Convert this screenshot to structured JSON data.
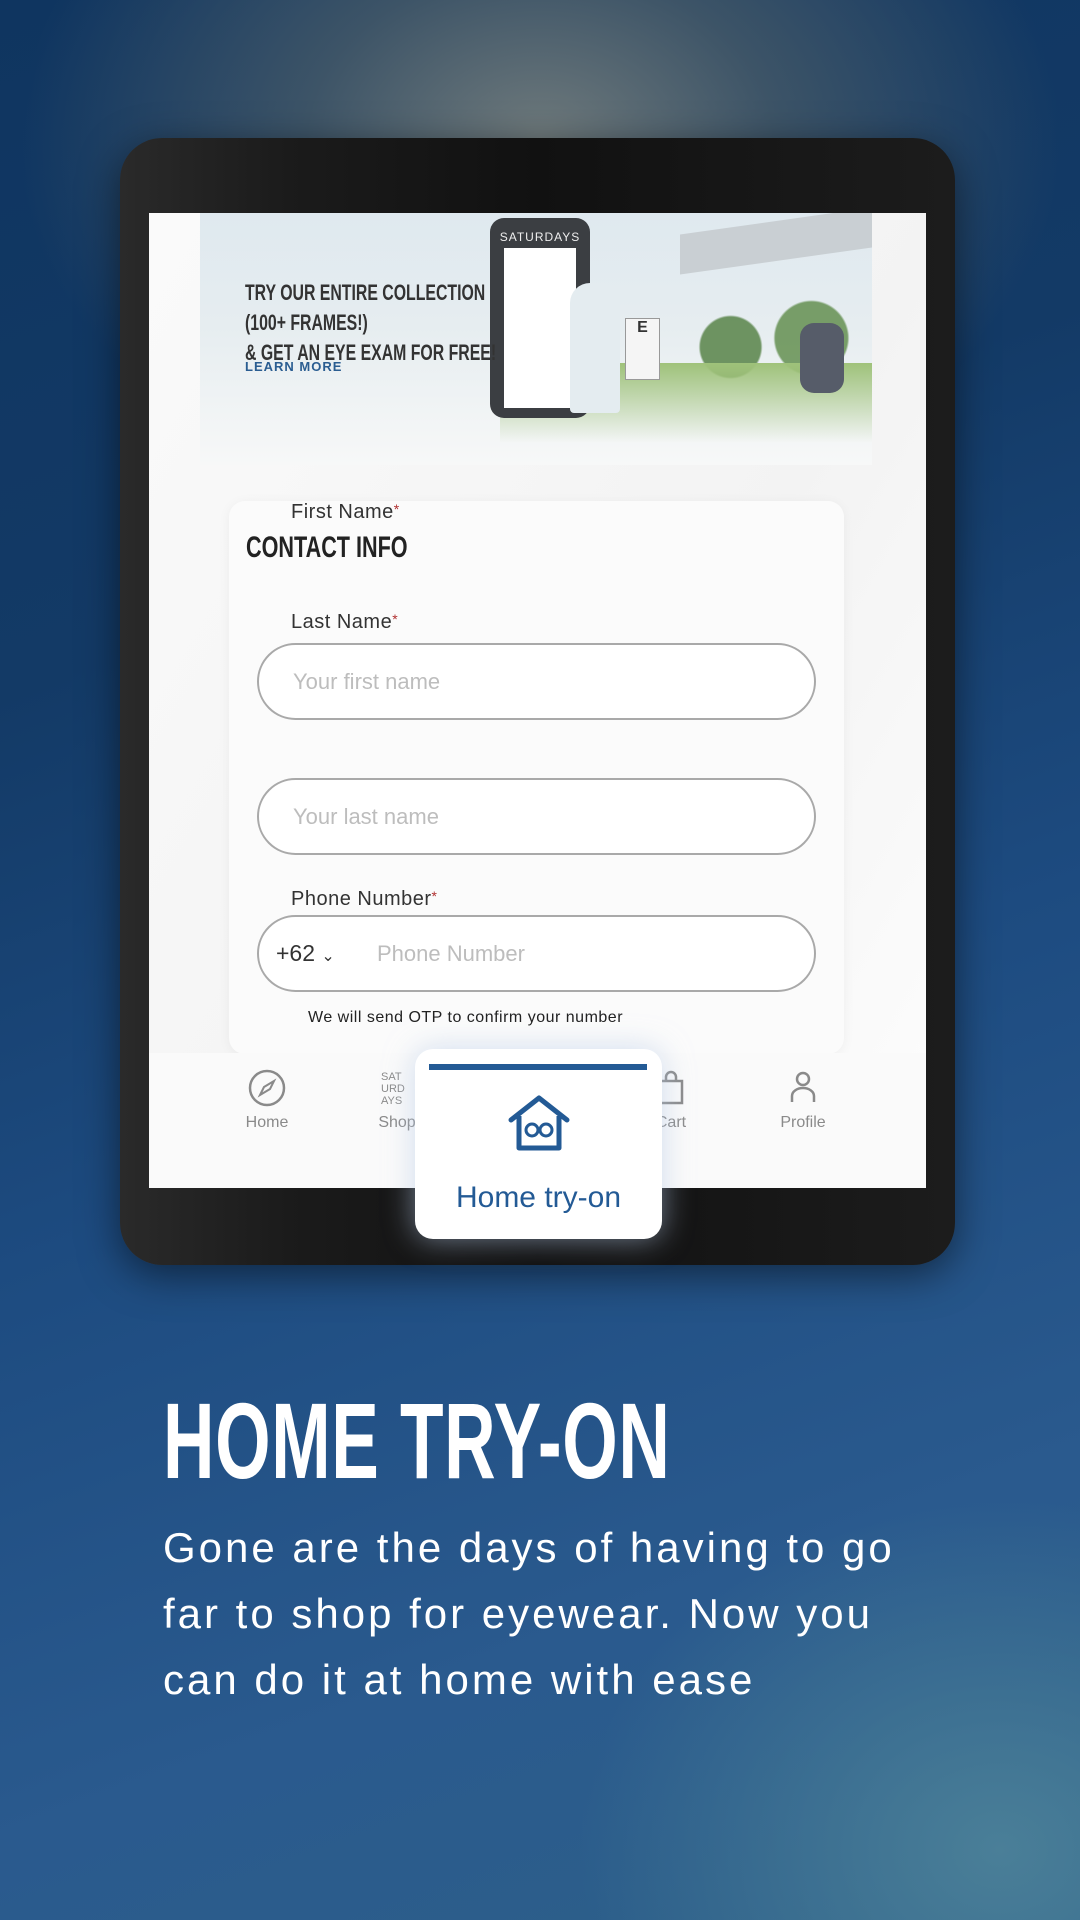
{
  "banner": {
    "headline": [
      "TRY OUR ENTIRE COLLECTION",
      "(100+ FRAMES!)",
      "& GET AN EYE EXAM FOR FREE!"
    ],
    "link": "LEARN MORE",
    "brand": "SATURDAYS"
  },
  "form": {
    "title": "CONTACT INFO",
    "required_mark": "*",
    "first_name": {
      "label": "First Name",
      "placeholder": "Your first name"
    },
    "last_name": {
      "label": "Last Name",
      "placeholder": "Your last name"
    },
    "phone": {
      "label": "Phone Number",
      "country_code": "+62",
      "placeholder": "Phone Number",
      "hint": "We will send OTP to confirm your number"
    }
  },
  "nav": {
    "items": [
      {
        "label": "Home",
        "icon": "compass-icon"
      },
      {
        "label": "Shop",
        "icon": "saturdays-logo-icon"
      },
      {
        "label": "Home try-on",
        "icon": "house-glasses-icon"
      },
      {
        "label": "Cart",
        "icon": "bag-icon"
      },
      {
        "label": "Profile",
        "icon": "person-icon"
      }
    ]
  },
  "promo": {
    "title": "HOME TRY-ON",
    "body": "Gone are the days of having to go far to shop for eyewear. Now you can do it at home with ease"
  },
  "colors": {
    "accent": "#235a95",
    "required": "#b03030"
  }
}
